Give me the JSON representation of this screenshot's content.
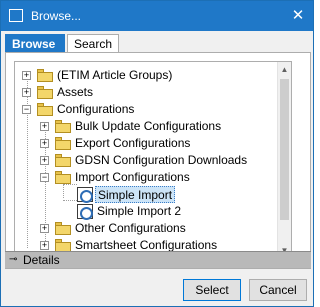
{
  "window": {
    "title": "Browse...",
    "close_glyph": "✕"
  },
  "tabs": [
    {
      "label": "Browse",
      "active": true
    },
    {
      "label": "Search",
      "active": false
    }
  ],
  "tree": {
    "items": [
      {
        "label": "(ETIM Article Groups)",
        "expander": "+",
        "icon": "folder-icon"
      },
      {
        "label": "Assets",
        "expander": "+",
        "icon": "folder-icon"
      },
      {
        "label": "Configurations",
        "expander": "−",
        "icon": "folder-icon"
      },
      {
        "label": "Bulk Update Configurations",
        "expander": "+",
        "icon": "folder-icon"
      },
      {
        "label": "Export Configurations",
        "expander": "+",
        "icon": "folder-icon"
      },
      {
        "label": "GDSN Configuration Downloads",
        "expander": "+",
        "icon": "folder-icon"
      },
      {
        "label": "Import Configurations",
        "expander": "−",
        "icon": "folder-icon"
      },
      {
        "label": "Simple Import",
        "icon": "import-config-icon",
        "selected": true
      },
      {
        "label": "Simple Import 2",
        "icon": "import-config-icon"
      },
      {
        "label": "Other Configurations",
        "expander": "+",
        "icon": "folder-icon"
      },
      {
        "label": "Smartsheet Configurations",
        "expander": "+",
        "icon": "folder-icon"
      }
    ]
  },
  "details": {
    "label": "Details",
    "icon": "key-icon"
  },
  "buttons": {
    "select": "Select",
    "cancel": "Cancel"
  },
  "colors": {
    "titlebar": "#1f78c8",
    "selection": "#cce4f7",
    "details_bar": "#b9b9b9"
  }
}
